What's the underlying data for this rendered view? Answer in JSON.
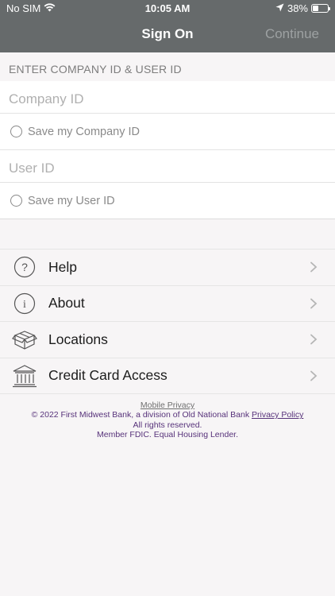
{
  "status_bar": {
    "carrier": "No SIM",
    "time": "10:05 AM",
    "battery": "38%",
    "battery_level": 0.38
  },
  "nav": {
    "title": "Sign On",
    "continue_label": "Continue"
  },
  "form": {
    "section_header": "ENTER COMPANY ID & USER ID",
    "company_id_placeholder": "Company ID",
    "save_company_label": "Save my Company ID",
    "user_id_placeholder": "User ID",
    "save_user_label": "Save my User ID"
  },
  "menu": {
    "items": [
      {
        "label": "Help",
        "icon": "question-circle-icon"
      },
      {
        "label": "About",
        "icon": "info-circle-icon"
      },
      {
        "label": "Locations",
        "icon": "box-icon"
      },
      {
        "label": "Credit Card Access",
        "icon": "bank-icon"
      }
    ]
  },
  "footer": {
    "mobile_privacy": "Mobile Privacy",
    "copyright": "© 2022 First Midwest Bank, a division of Old National Bank",
    "privacy_policy": "Privacy Policy",
    "rights": "All rights reserved.",
    "fdic": "Member FDIC. Equal Housing Lender."
  },
  "colors": {
    "header_bg": "#666a6b",
    "footer_text": "#57327a",
    "page_bg": "#f7f5f6"
  }
}
